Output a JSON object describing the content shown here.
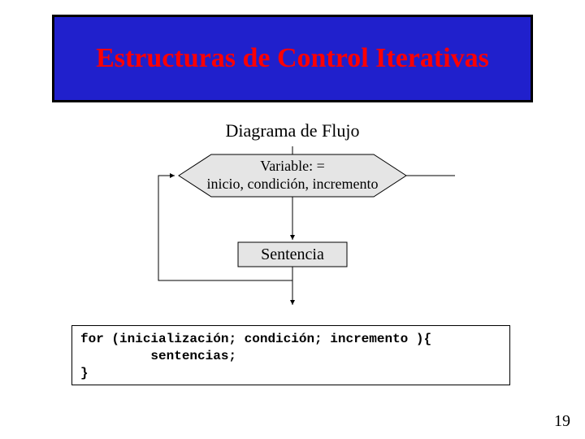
{
  "title": "Estructuras de Control Iterativas",
  "subtitle": "Diagrama de Flujo",
  "flow": {
    "hex_line1": "Variable: =",
    "hex_line2": "inicio, condición, incremento",
    "box": "Sentencia"
  },
  "code": {
    "keyword": "for",
    "line1_rest": " (inicialización; condición; incremento ){",
    "line2": "         sentencias;",
    "line3": "}"
  },
  "page_number": "19"
}
